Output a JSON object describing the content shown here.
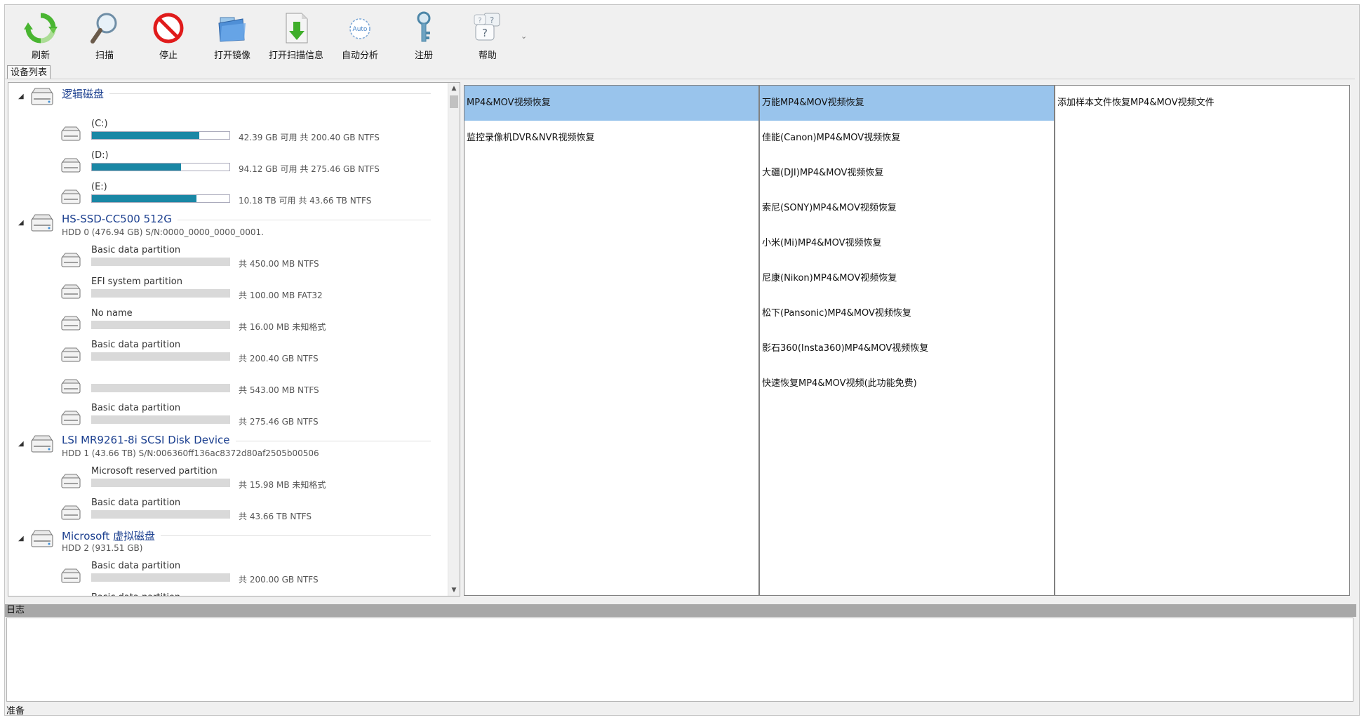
{
  "toolbar": {
    "refresh": "刷新",
    "scan": "扫描",
    "stop": "停止",
    "open_image": "打开镜像",
    "open_scan_info": "打开扫描信息",
    "auto_analyze": "自动分析",
    "auto_badge": "Auto",
    "register": "注册",
    "help": "帮助",
    "more": "⌄"
  },
  "device_tab": "设备列表",
  "disks": [
    {
      "name": "逻辑磁盘",
      "sub": "",
      "partitions": [
        {
          "label": "(C:)",
          "info": "42.39 GB 可用 共 200.40 GB NTFS",
          "used_fraction": 0.78
        },
        {
          "label": "(D:)",
          "info": "94.12 GB 可用 共 275.46 GB NTFS",
          "used_fraction": 0.65
        },
        {
          "label": "(E:)",
          "info": "10.18 TB 可用 共 43.66 TB NTFS",
          "used_fraction": 0.76
        }
      ]
    },
    {
      "name": "HS-SSD-CC500 512G",
      "sub": "HDD 0 (476.94 GB) S/N:0000_0000_0000_0001.",
      "partitions": [
        {
          "label": "Basic data partition",
          "info": "共 450.00 MB NTFS"
        },
        {
          "label": "EFI system partition",
          "info": "共 100.00 MB FAT32"
        },
        {
          "label": "No name",
          "info": "共 16.00 MB 未知格式"
        },
        {
          "label": "Basic data partition",
          "info": "共 200.40 GB NTFS"
        },
        {
          "label": "",
          "info": "共 543.00 MB NTFS"
        },
        {
          "label": "Basic data partition",
          "info": "共 275.46 GB NTFS"
        }
      ]
    },
    {
      "name": "LSI MR9261-8i SCSI Disk Device",
      "sub": "HDD 1 (43.66 TB) S/N:006360ff136ac8372d80af2505b00506",
      "partitions": [
        {
          "label": "Microsoft reserved partition",
          "info": "共 15.98 MB 未知格式"
        },
        {
          "label": "Basic data partition",
          "info": "共 43.66 TB NTFS"
        }
      ]
    },
    {
      "name": "Microsoft 虚拟磁盘",
      "sub": "HDD 2 (931.51 GB)",
      "partitions": [
        {
          "label": "Basic data partition",
          "info": "共 200.00 GB NTFS"
        },
        {
          "label": "Basic data partition",
          "info": ""
        }
      ]
    }
  ],
  "columns": [
    {
      "items": [
        "MP4&MOV视频恢复",
        "监控录像机DVR&NVR视频恢复"
      ],
      "selected": 0
    },
    {
      "items": [
        "万能MP4&MOV视频恢复",
        "佳能(Canon)MP4&MOV视频恢复",
        "大疆(DJI)MP4&MOV视频恢复",
        "索尼(SONY)MP4&MOV视频恢复",
        "小米(Mi)MP4&MOV视频恢复",
        "尼康(Nikon)MP4&MOV视频恢复",
        "松下(Pansonic)MP4&MOV视频恢复",
        "影石360(Insta360)MP4&MOV视频恢复",
        "快速恢复MP4&MOV视频(此功能免费)"
      ],
      "selected": 0
    },
    {
      "items": [
        "添加样本文件恢复MP4&MOV视频文件"
      ],
      "selected": -1
    }
  ],
  "log_title": "日志",
  "status": "准备",
  "colors": {
    "selection": "#99c4ec",
    "bar_fill": "#1a87a5",
    "disk_name": "#1b3f8f",
    "log_header": "#a8a8a8"
  }
}
